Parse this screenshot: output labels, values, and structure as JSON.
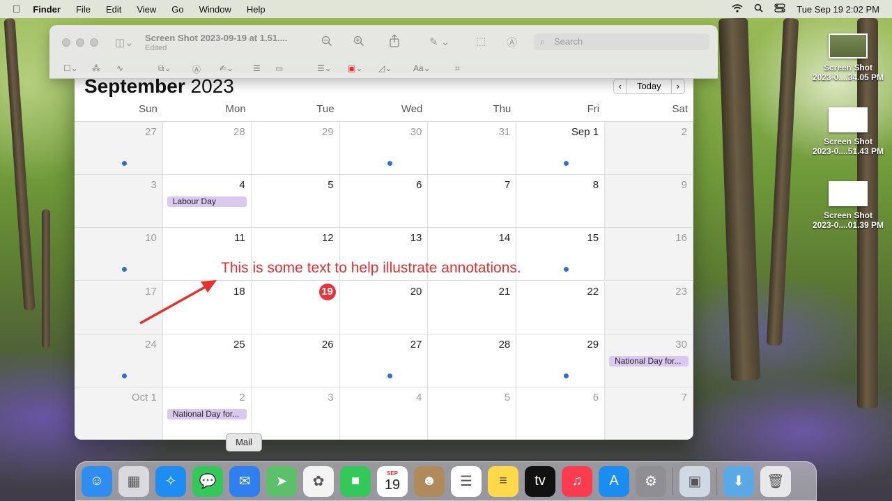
{
  "menubar": {
    "apple": "",
    "app_name": "Finder",
    "menus": [
      "File",
      "Edit",
      "View",
      "Go",
      "Window",
      "Help"
    ],
    "status_icons": [
      "wifi-icon",
      "search-icon",
      "control-center-icon"
    ],
    "clock": "Tue Sep 19  2:02 PM"
  },
  "preview": {
    "title": "Screen Shot 2023-09-19 at 1.51....",
    "subtitle": "Edited",
    "search_placeholder": "Search",
    "text_style_label": "Aa"
  },
  "calendar": {
    "month": "September",
    "year": "2023",
    "today_button": "Today",
    "prev": "‹",
    "next": "›",
    "weekdays": [
      "Sun",
      "Mon",
      "Tue",
      "Wed",
      "Thu",
      "Fri",
      "Sat"
    ],
    "weeks": [
      [
        {
          "n": "27",
          "dim": true,
          "dot": true
        },
        {
          "n": "28",
          "dim": true
        },
        {
          "n": "29",
          "dim": true
        },
        {
          "n": "30",
          "dim": true,
          "dot": true
        },
        {
          "n": "31",
          "dim": true
        },
        {
          "n": "Sep 1",
          "dot": true
        },
        {
          "n": "2",
          "dim": true
        }
      ],
      [
        {
          "n": "3",
          "dim": true
        },
        {
          "n": "4",
          "event": "Labour Day"
        },
        {
          "n": "5"
        },
        {
          "n": "6"
        },
        {
          "n": "7"
        },
        {
          "n": "8"
        },
        {
          "n": "9",
          "dim": true
        }
      ],
      [
        {
          "n": "10",
          "dim": true,
          "dot": true
        },
        {
          "n": "11"
        },
        {
          "n": "12"
        },
        {
          "n": "13"
        },
        {
          "n": "14"
        },
        {
          "n": "15",
          "dot": true
        },
        {
          "n": "16",
          "dim": true
        }
      ],
      [
        {
          "n": "17",
          "dim": true
        },
        {
          "n": "18"
        },
        {
          "n": "19",
          "today": true
        },
        {
          "n": "20"
        },
        {
          "n": "21"
        },
        {
          "n": "22"
        },
        {
          "n": "23",
          "dim": true
        }
      ],
      [
        {
          "n": "24",
          "dim": true,
          "dot": true
        },
        {
          "n": "25"
        },
        {
          "n": "26"
        },
        {
          "n": "27",
          "dot": true
        },
        {
          "n": "28"
        },
        {
          "n": "29",
          "dot": true
        },
        {
          "n": "30",
          "dim": true,
          "event": "National Day for..."
        }
      ],
      [
        {
          "n": "Oct 1",
          "dim": true
        },
        {
          "n": "2",
          "dim": true,
          "event": "National Day for..."
        },
        {
          "n": "3",
          "dim": true
        },
        {
          "n": "4",
          "dim": true
        },
        {
          "n": "5",
          "dim": true
        },
        {
          "n": "6",
          "dim": true
        },
        {
          "n": "7",
          "dim": true
        }
      ]
    ]
  },
  "annotation": {
    "text": "This is some text to help illustrate annotations.",
    "color": "#e53030"
  },
  "desktop_files": [
    {
      "line1": "Screen Shot",
      "line2": "2023-0....34.05 PM"
    },
    {
      "line1": "Screen Shot",
      "line2": "2023-0....51.43 PM"
    },
    {
      "line1": "Screen Shot",
      "line2": "2023-0....01.39 PM"
    }
  ],
  "tooltip": "Mail",
  "dock": {
    "apps": [
      {
        "name": "finder-icon",
        "glyph": "☺",
        "color": "#2f8cf0"
      },
      {
        "name": "launchpad-icon",
        "glyph": "▦",
        "color": "#d9d9de"
      },
      {
        "name": "safari-icon",
        "glyph": "✧",
        "color": "#1e8cf0"
      },
      {
        "name": "messages-icon",
        "glyph": "💬",
        "color": "#34c759"
      },
      {
        "name": "mail-icon",
        "glyph": "✉",
        "color": "#2f7ff0"
      },
      {
        "name": "maps-icon",
        "glyph": "➤",
        "color": "#5cbf6a"
      },
      {
        "name": "photos-icon",
        "glyph": "✿",
        "color": "#f4f4f4"
      },
      {
        "name": "facetime-icon",
        "glyph": "■",
        "color": "#34c759"
      },
      {
        "name": "calendar-icon",
        "glyph": "19",
        "color": "#ffffff",
        "month": "SEP"
      },
      {
        "name": "contacts-icon",
        "glyph": "☻",
        "color": "#b08a5a"
      },
      {
        "name": "reminders-icon",
        "glyph": "☰",
        "color": "#ffffff"
      },
      {
        "name": "notes-icon",
        "glyph": "≡",
        "color": "#ffd94a"
      },
      {
        "name": "apple-tv-icon",
        "glyph": "tv",
        "color": "#111111"
      },
      {
        "name": "music-icon",
        "glyph": "♫",
        "color": "#fb3c50"
      },
      {
        "name": "app-store-icon",
        "glyph": "A",
        "color": "#1b8cf0"
      },
      {
        "name": "system-preferences-icon",
        "glyph": "⚙",
        "color": "#8e8e93"
      }
    ],
    "right_apps": [
      {
        "name": "preview-icon",
        "glyph": "▣",
        "color": "#cfd8e3"
      },
      {
        "name": "downloads-folder-icon",
        "glyph": "⬇",
        "color": "#5aa9e6"
      },
      {
        "name": "trash-icon",
        "glyph": "🗑",
        "color": "#e8e8ea"
      }
    ]
  }
}
